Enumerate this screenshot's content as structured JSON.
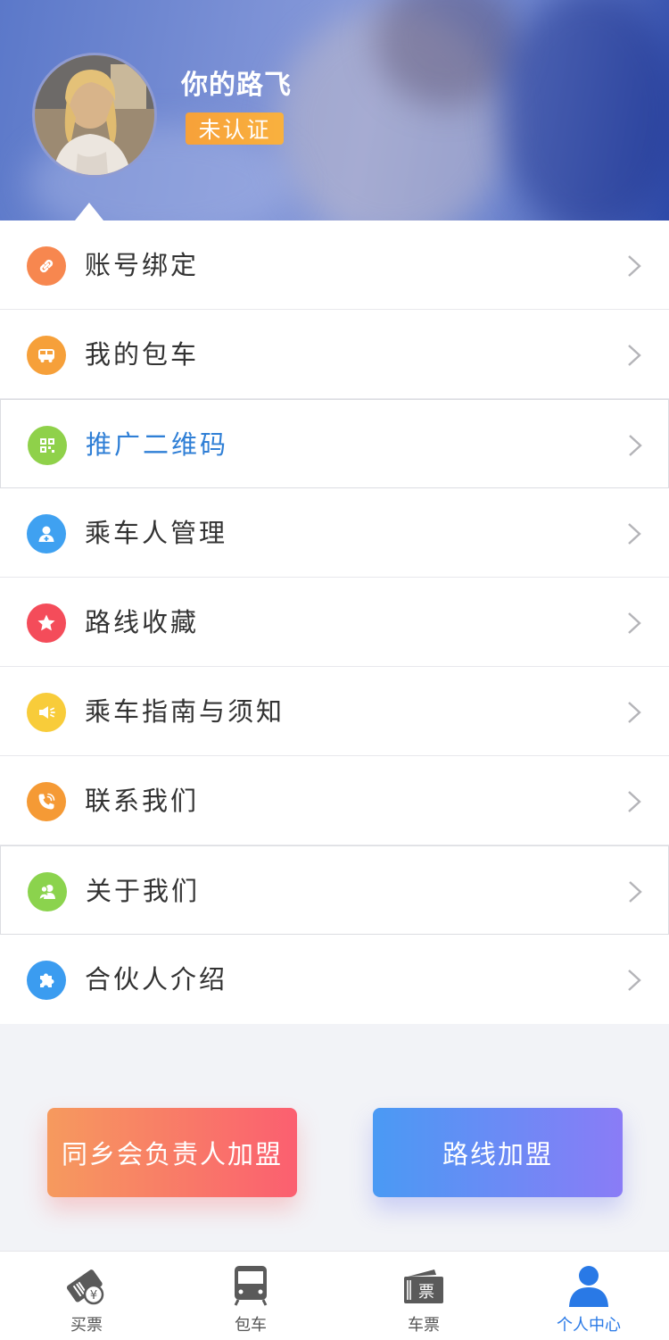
{
  "profile": {
    "username": "你的路飞",
    "status_badge": "未认证"
  },
  "menu": {
    "items": [
      {
        "label": "账号绑定",
        "icon": "link-icon",
        "color": "#f7874f"
      },
      {
        "label": "我的包车",
        "icon": "bus-icon",
        "color": "#f6a03a"
      },
      {
        "label": "推广二维码",
        "icon": "qr-code-icon",
        "color": "#8fd14a"
      },
      {
        "label": "乘车人管理",
        "icon": "passenger-icon",
        "color": "#3fa1f1"
      },
      {
        "label": "路线收藏",
        "icon": "star-icon",
        "color": "#f44c5a"
      },
      {
        "label": "乘车指南与须知",
        "icon": "megaphone-icon",
        "color": "#f8cc3a"
      },
      {
        "label": "联系我们",
        "icon": "phone-icon",
        "color": "#f59a35"
      },
      {
        "label": "关于我们",
        "icon": "users-icon",
        "color": "#8bd34d"
      },
      {
        "label": "合伙人介绍",
        "icon": "puzzle-icon",
        "color": "#3b9cf0"
      }
    ],
    "active_color": "#2f7fd6"
  },
  "actions": {
    "left_label": "同乡会负责人加盟",
    "right_label": "路线加盟"
  },
  "tabbar": {
    "tabs": [
      {
        "label": "买票",
        "icon": "ticket-buy-icon"
      },
      {
        "label": "包车",
        "icon": "bus-icon"
      },
      {
        "label": "车票",
        "icon": "tickets-icon"
      },
      {
        "label": "个人中心",
        "icon": "person-icon"
      }
    ],
    "active_color": "#2979e6"
  }
}
